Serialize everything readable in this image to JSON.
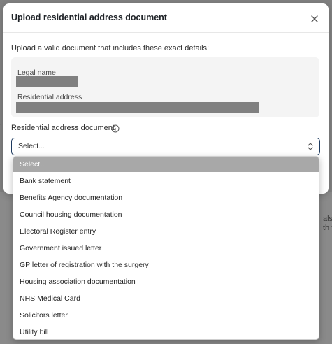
{
  "modal": {
    "title": "Upload residential address document",
    "close_icon": "close-icon",
    "intro": "Upload a valid document that includes these exact details:",
    "details": {
      "legal_name_label": "Legal name",
      "residential_address_label": "Residential address"
    },
    "field": {
      "label": "Residential address document",
      "info_icon": "info-icon",
      "selected_value": "Select...",
      "chevron_icon": "chevron-up-down-icon"
    }
  },
  "dropdown": {
    "options": [
      "Select...",
      "Bank statement",
      "Benefits Agency documentation",
      "Council housing documentation",
      "Electoral Register entry",
      "Government issued letter",
      "GP letter of registration with the surgery",
      "Housing association documentation",
      "NHS Medical Card",
      "Solicitors letter",
      "Utility bill"
    ],
    "highlighted_index": 0
  },
  "background": {
    "text_1": "also",
    "text_2": "th th"
  },
  "colors": {
    "overlay": "#808080",
    "modal_bg": "#ffffff",
    "details_bg": "#f4f4f4",
    "select_border": "#1d3a5f",
    "option_highlight": "#a8a8a8"
  }
}
